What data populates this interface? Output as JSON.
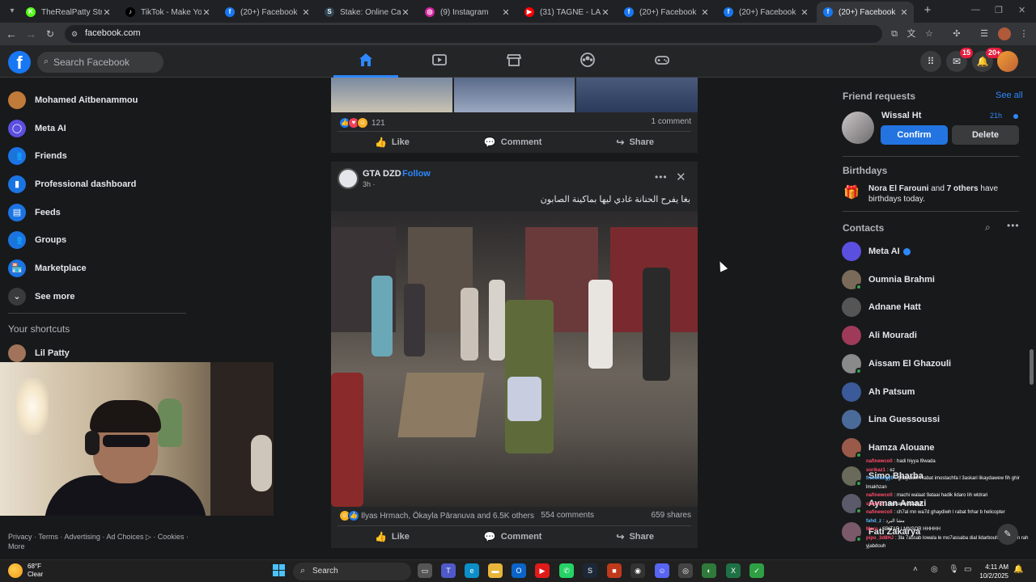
{
  "browser": {
    "tabs": [
      {
        "title": "TheRealPatty Stream",
        "favicon": "kick-icon",
        "color": "#53fc18",
        "glyph": "K"
      },
      {
        "title": "TikTok - Make Your Day",
        "favicon": "tiktok-icon",
        "color": "#000000",
        "glyph": "♪"
      },
      {
        "title": "(20+) Facebook",
        "favicon": "facebook-icon",
        "color": "#1877f2",
        "glyph": "f"
      },
      {
        "title": "Stake: Online Casino",
        "favicon": "stake-icon",
        "color": "#2f4553",
        "glyph": "S"
      },
      {
        "title": "(9) Instagram",
        "favicon": "instagram-icon",
        "color": "#d6249f",
        "glyph": "◎"
      },
      {
        "title": "(31) TAGNE - LA HAINE",
        "favicon": "youtube-icon",
        "color": "#ff0000",
        "glyph": "▶"
      },
      {
        "title": "(20+) Facebook",
        "favicon": "facebook-icon",
        "color": "#1877f2",
        "glyph": "f"
      },
      {
        "title": "(20+) Facebook",
        "favicon": "facebook-icon",
        "color": "#1877f2",
        "glyph": "f"
      },
      {
        "title": "(20+) Facebook",
        "favicon": "facebook-icon",
        "color": "#1877f2",
        "glyph": "f",
        "active": true
      }
    ],
    "url": "facebook.com"
  },
  "header": {
    "search_placeholder": "Search Facebook",
    "messenger_badge": "15",
    "notifications_badge": "20+"
  },
  "sidebar": {
    "items": [
      {
        "label": "Mohamed Aitbenammou",
        "icon": "profile-avatar",
        "color": "#c07a3a"
      },
      {
        "label": "Meta AI",
        "icon": "meta-ai-icon",
        "color": "#5b4fe0"
      },
      {
        "label": "Friends",
        "icon": "friends-icon",
        "color": "#1b74e4"
      },
      {
        "label": "Professional dashboard",
        "icon": "dashboard-icon",
        "color": "#1b74e4"
      },
      {
        "label": "Feeds",
        "icon": "feeds-icon",
        "color": "#1b74e4"
      },
      {
        "label": "Groups",
        "icon": "groups-icon",
        "color": "#1b74e4"
      },
      {
        "label": "Marketplace",
        "icon": "marketplace-icon",
        "color": "#1b74e4"
      },
      {
        "label": "See more",
        "icon": "chevron-down-icon",
        "color": "#3a3b3c"
      }
    ],
    "shortcuts_heading": "Your shortcuts",
    "shortcuts": [
      {
        "label": "Lil Patty",
        "icon": "avatar"
      }
    ],
    "footer": "Privacy · Terms · Advertising · Ad Choices ▷ · Cookies · More"
  },
  "feed": {
    "post1": {
      "reaction_count": "121",
      "comments": "1 comment",
      "actions": {
        "like": "Like",
        "comment": "Comment",
        "share": "Share"
      }
    },
    "post2": {
      "author": "GTA DZD",
      "dot": "·",
      "follow": "Follow",
      "time": "3h ·",
      "caption": "بغا يفرح الحنانة غادي ليها بماكينة الصابون",
      "reactions_text": "Ilyas Hrmach, Ökayla Pāranuva and 6.5K others",
      "comments": "554 comments",
      "shares": "659 shares",
      "actions": {
        "like": "Like",
        "comment": "Comment",
        "share": "Share"
      }
    }
  },
  "rightcol": {
    "friend_requests": {
      "heading": "Friend requests",
      "see_all": "See all",
      "name": "Wissal Ht",
      "time": "21h",
      "confirm": "Confirm",
      "delete": "Delete"
    },
    "birthdays": {
      "heading": "Birthdays",
      "name": "Nora El Farouni",
      "others": "7 others",
      "connector": "and",
      "suffix": "have birthdays today."
    },
    "contacts_heading": "Contacts",
    "contacts": [
      {
        "name": "Meta AI",
        "color": "#5b4fe0",
        "verified": true,
        "online": false
      },
      {
        "name": "Oumnia Brahmi",
        "color": "#7a6a5a",
        "online": true
      },
      {
        "name": "Adnane Hatt",
        "color": "#555555",
        "online": false
      },
      {
        "name": "Ali Mouradi",
        "color": "#a03a5a",
        "online": false
      },
      {
        "name": "Aissam El Ghazouli",
        "color": "#8a8a8a",
        "online": true
      },
      {
        "name": "Ah Patsum",
        "color": "#3a5a9a",
        "online": false
      },
      {
        "name": "Lina Guessoussi",
        "color": "#4a6a9a",
        "online": false
      },
      {
        "name": "Hamza Alouane",
        "color": "#9a5a4a",
        "online": true
      },
      {
        "name": "Simo Bharba",
        "color": "#6a6a5a",
        "online": true
      },
      {
        "name": "Ayman Amazi",
        "color": "#5a5a6a",
        "online": true
      },
      {
        "name": "Fati Zakarya",
        "color": "#7a5a6a",
        "online": true
      }
    ]
  },
  "chat_overlay": [
    {
      "user": "nafinewcoll",
      "text": ": hadi hiyya l9wada",
      "style": "u"
    },
    {
      "user": "sorikaz1",
      "text": ": ez",
      "style": "u"
    },
    {
      "user": "freeenergy0",
      "text": ": ghaydiwh l rabat imostachfa l 3askari likaydawew fih ghir lmakhzan",
      "style": "u2"
    },
    {
      "user": "nafinewcoll",
      "text": ": machi walaat 9ataai hadik lidaro lih wldrari",
      "style": "u"
    },
    {
      "user": "short71",
      "text": ": mohamed aalah",
      "style": "u"
    },
    {
      "user": "nafinewcoll",
      "text": ": ch7al mn wa7d ghaydiwh l rabat fnhar b helicopter",
      "style": "u"
    },
    {
      "user": "fahd_z",
      "text": ": مشا البرد",
      "style": "u2"
    },
    {
      "user": "Moro",
      "text": ": SBITAR LMNSOR HHHHH",
      "style": "u"
    },
    {
      "user": "pipo_3d8HJ",
      "text": ": 3la 7assab lowala le mo7assaba dial lidarbouh ra2y 3am rah yjabdouh",
      "style": "u"
    }
  ],
  "taskbar": {
    "temp": "68°F",
    "weather": "Clear",
    "search": "Search",
    "time": "4:11 AM",
    "date": "10/2/2025"
  }
}
